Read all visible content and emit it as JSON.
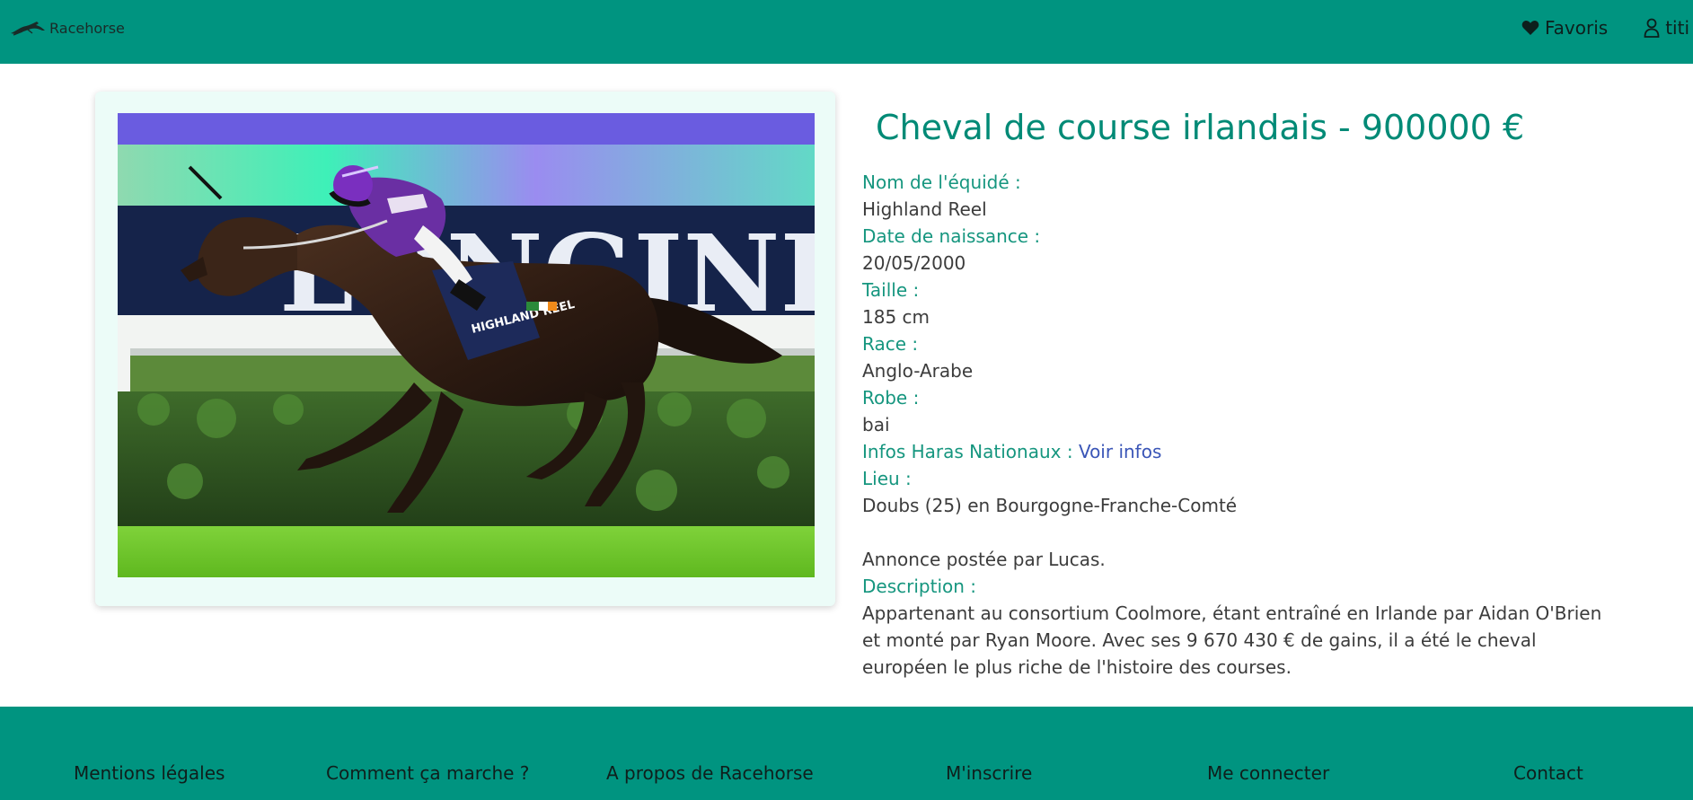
{
  "header": {
    "brand": "Racehorse",
    "logo_icon": "horse-logo-icon",
    "favorites_label": "Favoris",
    "favorites_icon": "heart-icon",
    "user_label": "titi",
    "user_icon": "user-icon",
    "background_color": "#009480"
  },
  "listing": {
    "title": "Cheval de course irlandais - 900000 €",
    "photo_alt": "Cheval de course au galop monté par un jockey",
    "fields": {
      "name_label": "Nom de l'équidé :",
      "name_value": "Highland Reel",
      "birth_label": "Date de naissance :",
      "birth_value": "20/05/2000",
      "height_label": "Taille :",
      "height_value": "185 cm",
      "breed_label": "Race :",
      "breed_value": "Anglo-Arabe",
      "coat_label": "Robe :",
      "coat_value": "bai",
      "haras_label": "Infos Haras Nationaux : ",
      "haras_link": "Voir infos",
      "location_label": "Lieu :",
      "location_value": "Doubs (25) en Bourgogne-Franche-Comté"
    },
    "posted_by": "Annonce postée par Lucas.",
    "description_label": "Description :",
    "description_text": "Appartenant au consortium Coolmore, étant entraîné en Irlande par Aidan O'Brien et monté par Ryan Moore. Avec ses 9 670 430 € de gains, il a été le cheval européen le plus riche de l'histoire des courses."
  },
  "footer": {
    "links": [
      "Mentions légales",
      "Comment ça marche ?",
      "A propos de Racehorse",
      "M'inscrire",
      "Me connecter",
      "Contact"
    ]
  },
  "colors": {
    "accent": "#009480",
    "label": "#16967f",
    "link": "#3a55b7",
    "card_bg": "#ecfcf8"
  }
}
